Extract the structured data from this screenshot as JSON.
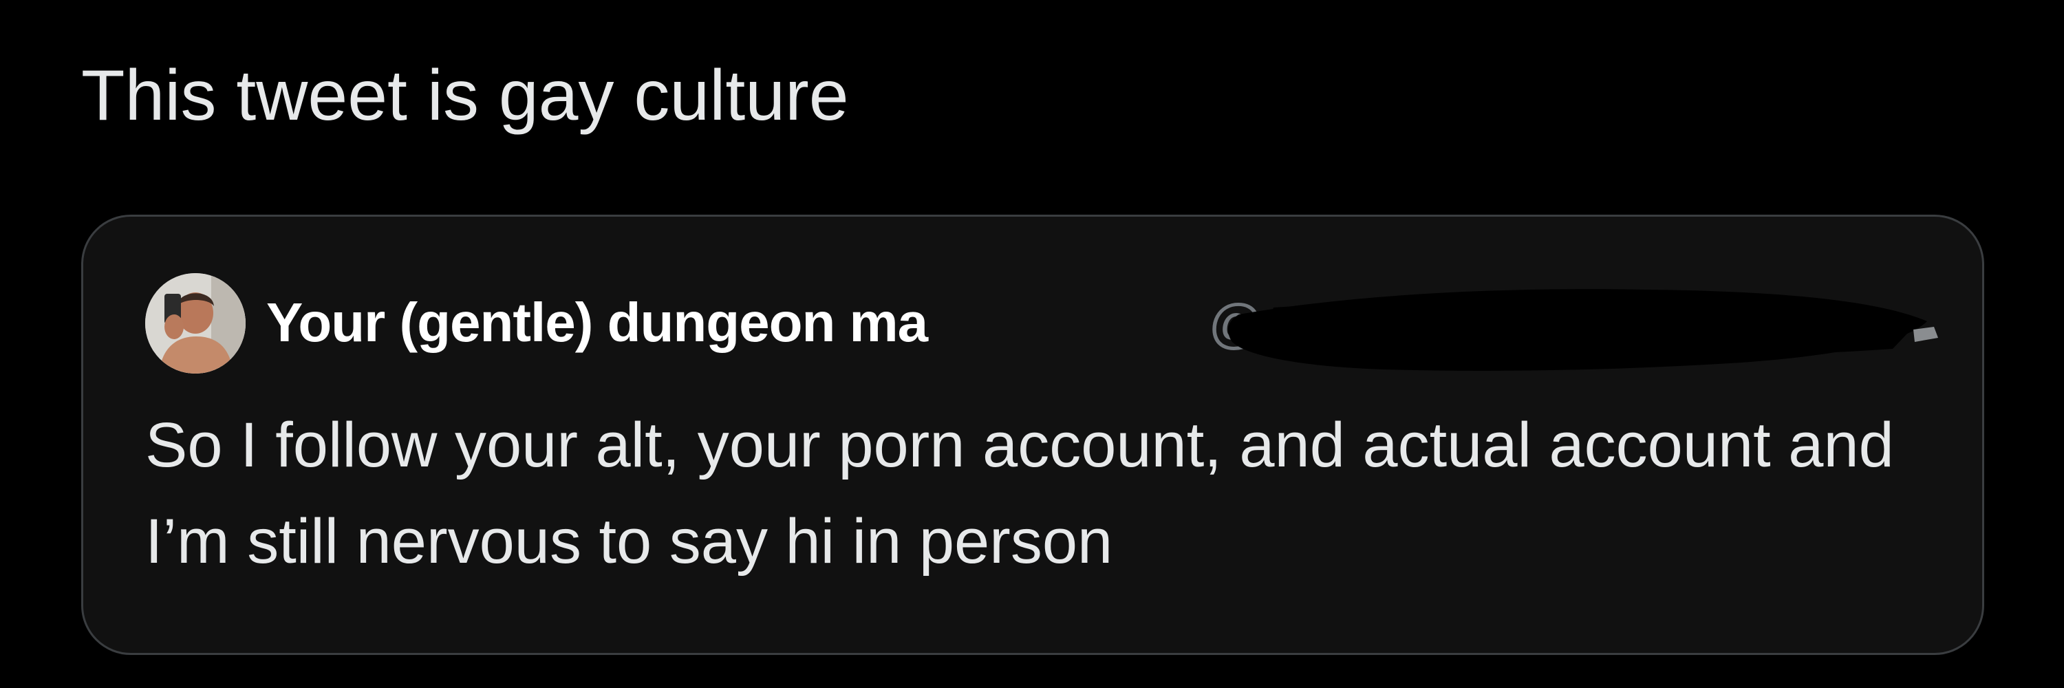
{
  "tweet": {
    "text": "This tweet is gay culture"
  },
  "quoted_tweet": {
    "display_name": "Your (gentle) dungeon ma",
    "handle": "@",
    "avatar_icon": "profile-photo",
    "text": "So I follow your alt, your porn account, and actual account and I’m still nervous to say hi in person"
  },
  "colors": {
    "background": "#000000",
    "card_background": "#111111",
    "card_border": "#3a3d40",
    "primary_text": "#e7e9ea",
    "secondary_text": "#71767b"
  }
}
